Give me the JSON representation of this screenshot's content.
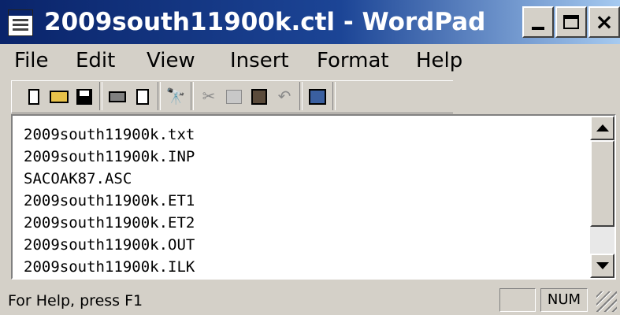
{
  "window": {
    "title": "2009south11900k.ctl - WordPad",
    "controls": {
      "minimize": "_",
      "close": "×"
    }
  },
  "menu": {
    "file": "File",
    "edit": "Edit",
    "view": "View",
    "insert": "Insert",
    "format": "Format",
    "help": "Help"
  },
  "toolbar": {
    "icons": [
      "new-document-icon",
      "open-folder-icon",
      "save-disk-icon",
      "print-icon",
      "print-preview-icon",
      "find-binoculars-icon",
      "cut-scissors-icon",
      "copy-icon",
      "paste-clipboard-icon",
      "undo-icon",
      "date-time-icon"
    ],
    "find_glyph": "🔭",
    "cut_glyph": "✂",
    "undo_glyph": "↶"
  },
  "document": {
    "lines": [
      "2009south11900k.txt",
      "2009south11900k.INP",
      "SACOAK87.ASC",
      "2009south11900k.ET1",
      "2009south11900k.ET2",
      "2009south11900k.OUT",
      "2009south11900k.ILK"
    ]
  },
  "status": {
    "help_text": "For Help, press F1",
    "panel_1": "",
    "num_indicator": "NUM"
  },
  "colors": {
    "title_gradient_start": "#0a246a",
    "title_gradient_end": "#a6caf0",
    "chrome": "#d4d0c8"
  }
}
